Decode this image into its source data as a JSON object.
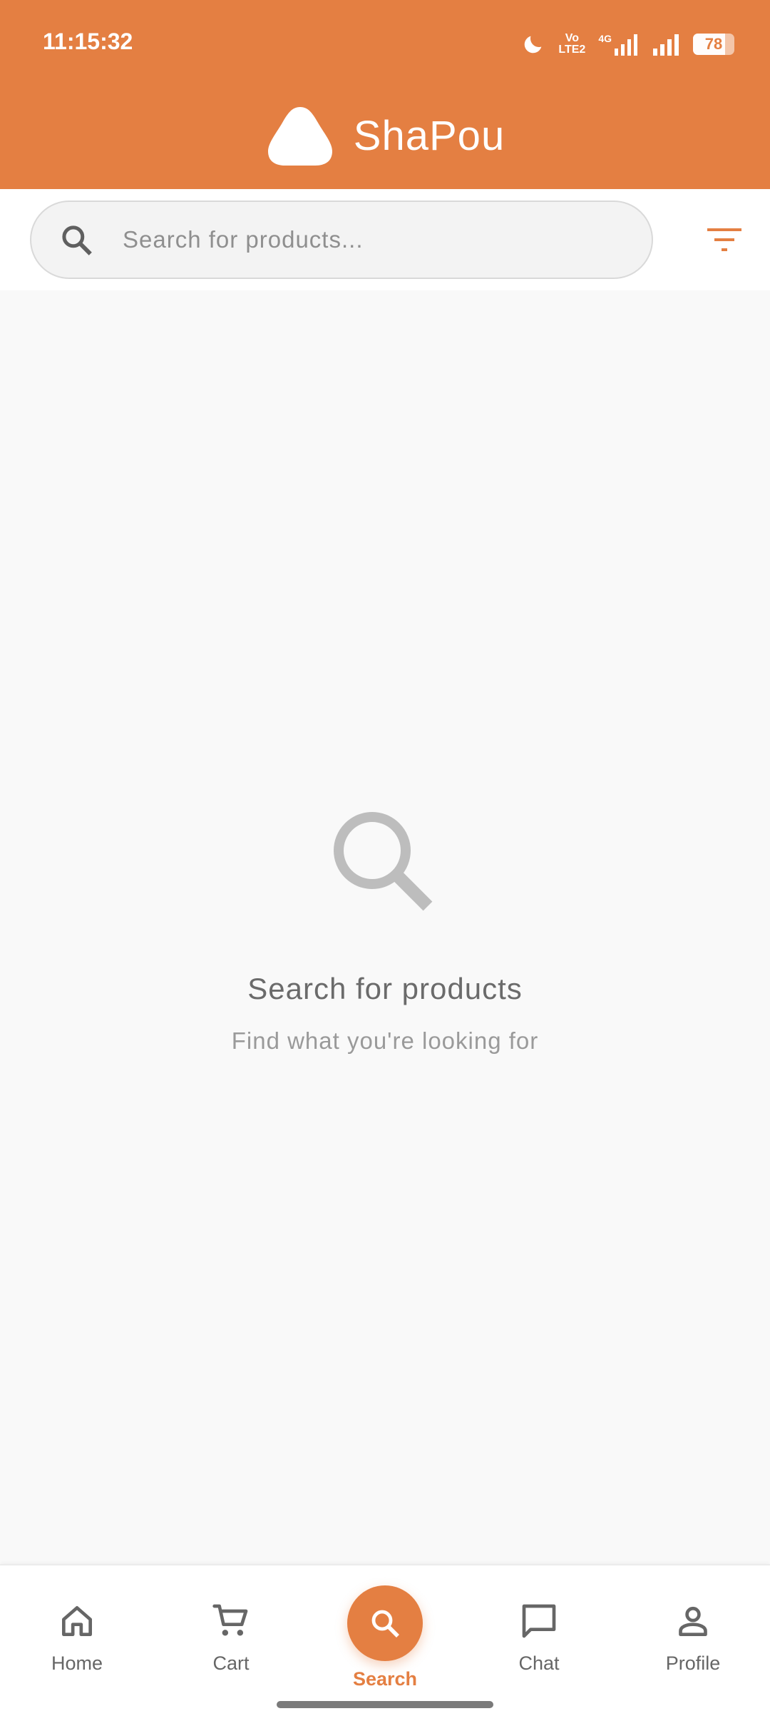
{
  "status_bar": {
    "time": "11:15:32",
    "volte_top": "Vo",
    "volte_bottom": "LTE2",
    "network": "4G",
    "battery": "78",
    "battery_level": 0.78
  },
  "header": {
    "app_name": "ShaPou",
    "background_color": "#e47f42"
  },
  "search": {
    "placeholder": "Search for products...",
    "value": ""
  },
  "empty_state": {
    "title": "Search for products",
    "subtitle": "Find what you're looking for"
  },
  "bottom_nav": {
    "items": [
      {
        "label": "Home",
        "icon": "home-icon"
      },
      {
        "label": "Cart",
        "icon": "cart-icon"
      },
      {
        "label": "Search",
        "icon": "search-icon",
        "active": true
      },
      {
        "label": "Chat",
        "icon": "chat-icon"
      },
      {
        "label": "Profile",
        "icon": "profile-icon"
      }
    ],
    "active_color": "#e47f42",
    "inactive_color": "#666666"
  }
}
